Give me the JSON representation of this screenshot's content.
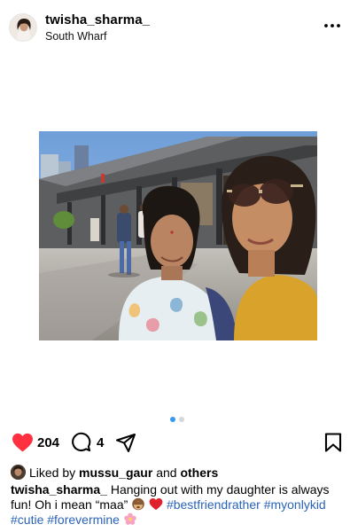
{
  "post": {
    "username": "twisha_sharma_",
    "location": "South Wharf",
    "more_icon": "more-horizontal-icon",
    "like_count": "204",
    "comment_count": "4",
    "liked_by": {
      "prefix": "Liked by",
      "user": "mussu_gaur",
      "connector": "and",
      "suffix": "others"
    },
    "caption": {
      "username": "twisha_sharma_",
      "text": "Hanging out with my daughter is always fun! Oh i mean “maa”",
      "hashtags": [
        "#bestfriendrather",
        "#myonlykid",
        "#cutie",
        "#forevermine"
      ]
    },
    "carousel": {
      "total": 2,
      "active_index": 0
    }
  },
  "colors": {
    "like_red": "#ff3040",
    "link_blue": "#2a63b8",
    "dot_active": "#3897f0",
    "dot_inactive": "#d6d6d6"
  }
}
